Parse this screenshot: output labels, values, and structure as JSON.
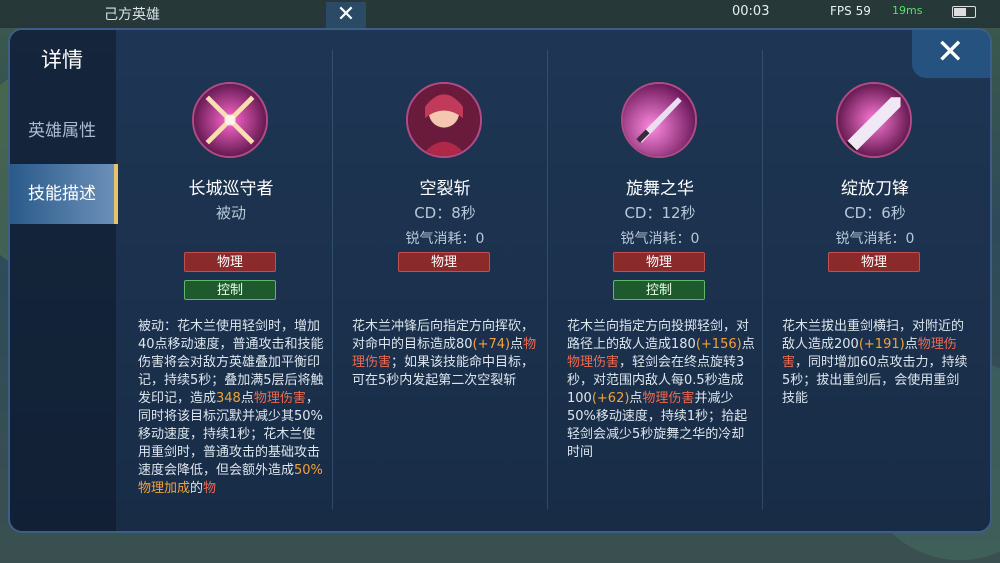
{
  "hud": {
    "team_label": "己方英雄",
    "timer": "00:03",
    "fps": "FPS 59",
    "ping": "19ms"
  },
  "panel": {
    "title": "详情",
    "tabs": [
      "英雄属性",
      "技能描述"
    ],
    "active_tab": "技能描述",
    "close_label": "✕"
  },
  "skills": [
    {
      "name": "长城巡守者",
      "line1": "被动",
      "line2": "",
      "icon": "crossed-swords-icon",
      "tags": [
        {
          "label": "物理",
          "color": "red"
        },
        {
          "label": "控制",
          "color": "green"
        }
      ],
      "desc": [
        {
          "t": "被动：花木兰使用轻剑时，增加40点移动速度，普通攻击和技能伤害将会对敌方英雄叠加平衡印记，持续5秒；叠加满5层后将触发印记，造成"
        },
        {
          "t": "348",
          "c": "hl"
        },
        {
          "t": "点"
        },
        {
          "t": "物理伤害",
          "c": "hm"
        },
        {
          "t": "，同时将该目标沉默并减少其50%移动速度，持续1秒；花木兰使用重剑时，普通攻击的基础攻击速度会降低，但会额外造成"
        },
        {
          "t": "50%物理加成",
          "c": "hl"
        },
        {
          "t": "的"
        },
        {
          "t": "物",
          "c": "hm"
        }
      ]
    },
    {
      "name": "空裂斩",
      "line1": "CD：8秒",
      "line2": "锐气消耗：0",
      "icon": "warrior-portrait-icon",
      "tags": [
        {
          "label": "物理",
          "color": "red"
        }
      ],
      "desc": [
        {
          "t": "花木兰冲锋后向指定方向挥砍，对命中的目标造成80"
        },
        {
          "t": "(+74)",
          "c": "hl"
        },
        {
          "t": "点"
        },
        {
          "t": "物理伤害",
          "c": "hm"
        },
        {
          "t": "；如果该技能命中目标，可在5秒内发起第二次空裂斩"
        }
      ]
    },
    {
      "name": "旋舞之华",
      "line1": "CD：12秒",
      "line2": "锐气消耗：0",
      "icon": "flying-blade-icon",
      "tags": [
        {
          "label": "物理",
          "color": "red"
        },
        {
          "label": "控制",
          "color": "green"
        }
      ],
      "desc": [
        {
          "t": "花木兰向指定方向投掷轻剑，对路径上的敌人造成180"
        },
        {
          "t": "(+156)",
          "c": "hl"
        },
        {
          "t": "点"
        },
        {
          "t": "物理伤害",
          "c": "hm"
        },
        {
          "t": "，轻剑会在终点旋转3秒，对范围内敌人每0.5秒造成100"
        },
        {
          "t": "(+62)",
          "c": "hl"
        },
        {
          "t": "点"
        },
        {
          "t": "物理伤害",
          "c": "hm"
        },
        {
          "t": "并减少50%移动速度，持续1秒；拾起轻剑会减少5秒旋舞之华的冷却时间"
        }
      ]
    },
    {
      "name": "绽放刀锋",
      "line1": "CD：6秒",
      "line2": "锐气消耗：0",
      "icon": "greatsword-icon",
      "tags": [
        {
          "label": "物理",
          "color": "red"
        }
      ],
      "desc": [
        {
          "t": "花木兰拔出重剑横扫，对附近的敌人造成200"
        },
        {
          "t": "(+191)",
          "c": "hl"
        },
        {
          "t": "点"
        },
        {
          "t": "物理伤害",
          "c": "hm"
        },
        {
          "t": "，同时增加60点攻击力，持续5秒；拔出重剑后，会使用重剑技能"
        }
      ]
    }
  ]
}
